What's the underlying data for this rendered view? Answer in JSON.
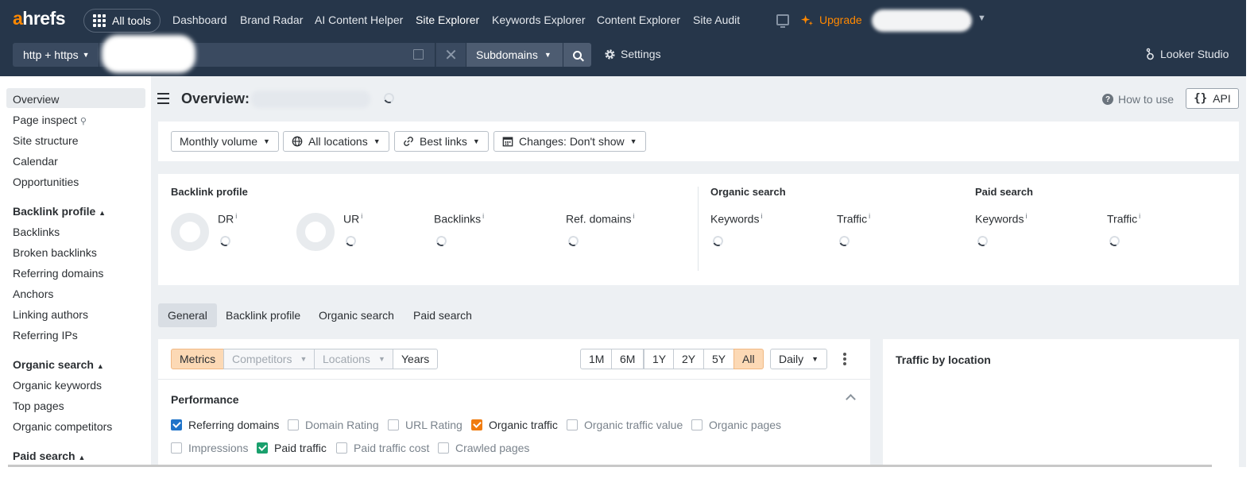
{
  "header": {
    "logo": {
      "first": "a",
      "rest": "hrefs"
    },
    "all_tools": "All tools",
    "nav": [
      "Dashboard",
      "Brand Radar",
      "AI Content Helper",
      "Site Explorer",
      "Keywords Explorer",
      "Content Explorer",
      "Site Audit"
    ],
    "active_nav": "Site Explorer",
    "upgrade": "Upgrade",
    "protocol": "http + https",
    "mode": "Subdomains",
    "settings": "Settings",
    "looker": "Looker Studio",
    "clear": "✕",
    "account_suffix": "."
  },
  "sidebar": {
    "items": [
      "Overview",
      "Page inspect",
      "Site structure",
      "Calendar",
      "Opportunities"
    ],
    "backlink_head": "Backlink profile",
    "backlink_items": [
      "Backlinks",
      "Broken backlinks",
      "Referring domains",
      "Anchors",
      "Linking authors",
      "Referring IPs"
    ],
    "organic_head": "Organic search",
    "organic_items": [
      "Organic keywords",
      "Top pages",
      "Organic competitors"
    ],
    "paid_head": "Paid search"
  },
  "main": {
    "title": "Overview:",
    "how_to_use": "How to use",
    "api": "API",
    "filters": [
      "Monthly volume",
      "All locations",
      "Best links",
      "Changes: Don't show"
    ],
    "backlink_profile": "Backlink profile",
    "organic_search": "Organic search",
    "paid_search": "Paid search",
    "metrics": {
      "dr": "DR",
      "ur": "UR",
      "backlinks": "Backlinks",
      "ref_domains": "Ref. domains",
      "org_keywords": "Keywords",
      "org_traffic": "Traffic",
      "paid_keywords": "Keywords",
      "paid_traffic": "Traffic",
      "info": "i"
    },
    "tabs": [
      "General",
      "Backlink profile",
      "Organic search",
      "Paid search"
    ],
    "active_tab": "General",
    "chart_tabs": [
      "Metrics",
      "Competitors",
      "Locations",
      "Years"
    ],
    "ranges": [
      "1M",
      "6M",
      "1Y",
      "2Y",
      "5Y",
      "All"
    ],
    "active_range": "All",
    "granularity": "Daily",
    "performance": "Performance",
    "checkboxes": [
      {
        "label": "Referring domains",
        "checked": true,
        "color": "#1f73c9"
      },
      {
        "label": "Domain Rating",
        "checked": false
      },
      {
        "label": "URL Rating",
        "checked": false
      },
      {
        "label": "Organic traffic",
        "checked": true,
        "color": "#f07b0e"
      },
      {
        "label": "Organic traffic value",
        "checked": false
      },
      {
        "label": "Organic pages",
        "checked": false
      },
      {
        "label": "Impressions",
        "checked": false
      },
      {
        "label": "Paid traffic",
        "checked": true,
        "color": "#1aa06d"
      },
      {
        "label": "Paid traffic cost",
        "checked": false
      },
      {
        "label": "Crawled pages",
        "checked": false
      }
    ],
    "traffic_by_location": "Traffic by location"
  },
  "colors": {
    "brand": "#ff8800",
    "header_bg": "#26364a",
    "selected_range": "#fcd9b5"
  }
}
